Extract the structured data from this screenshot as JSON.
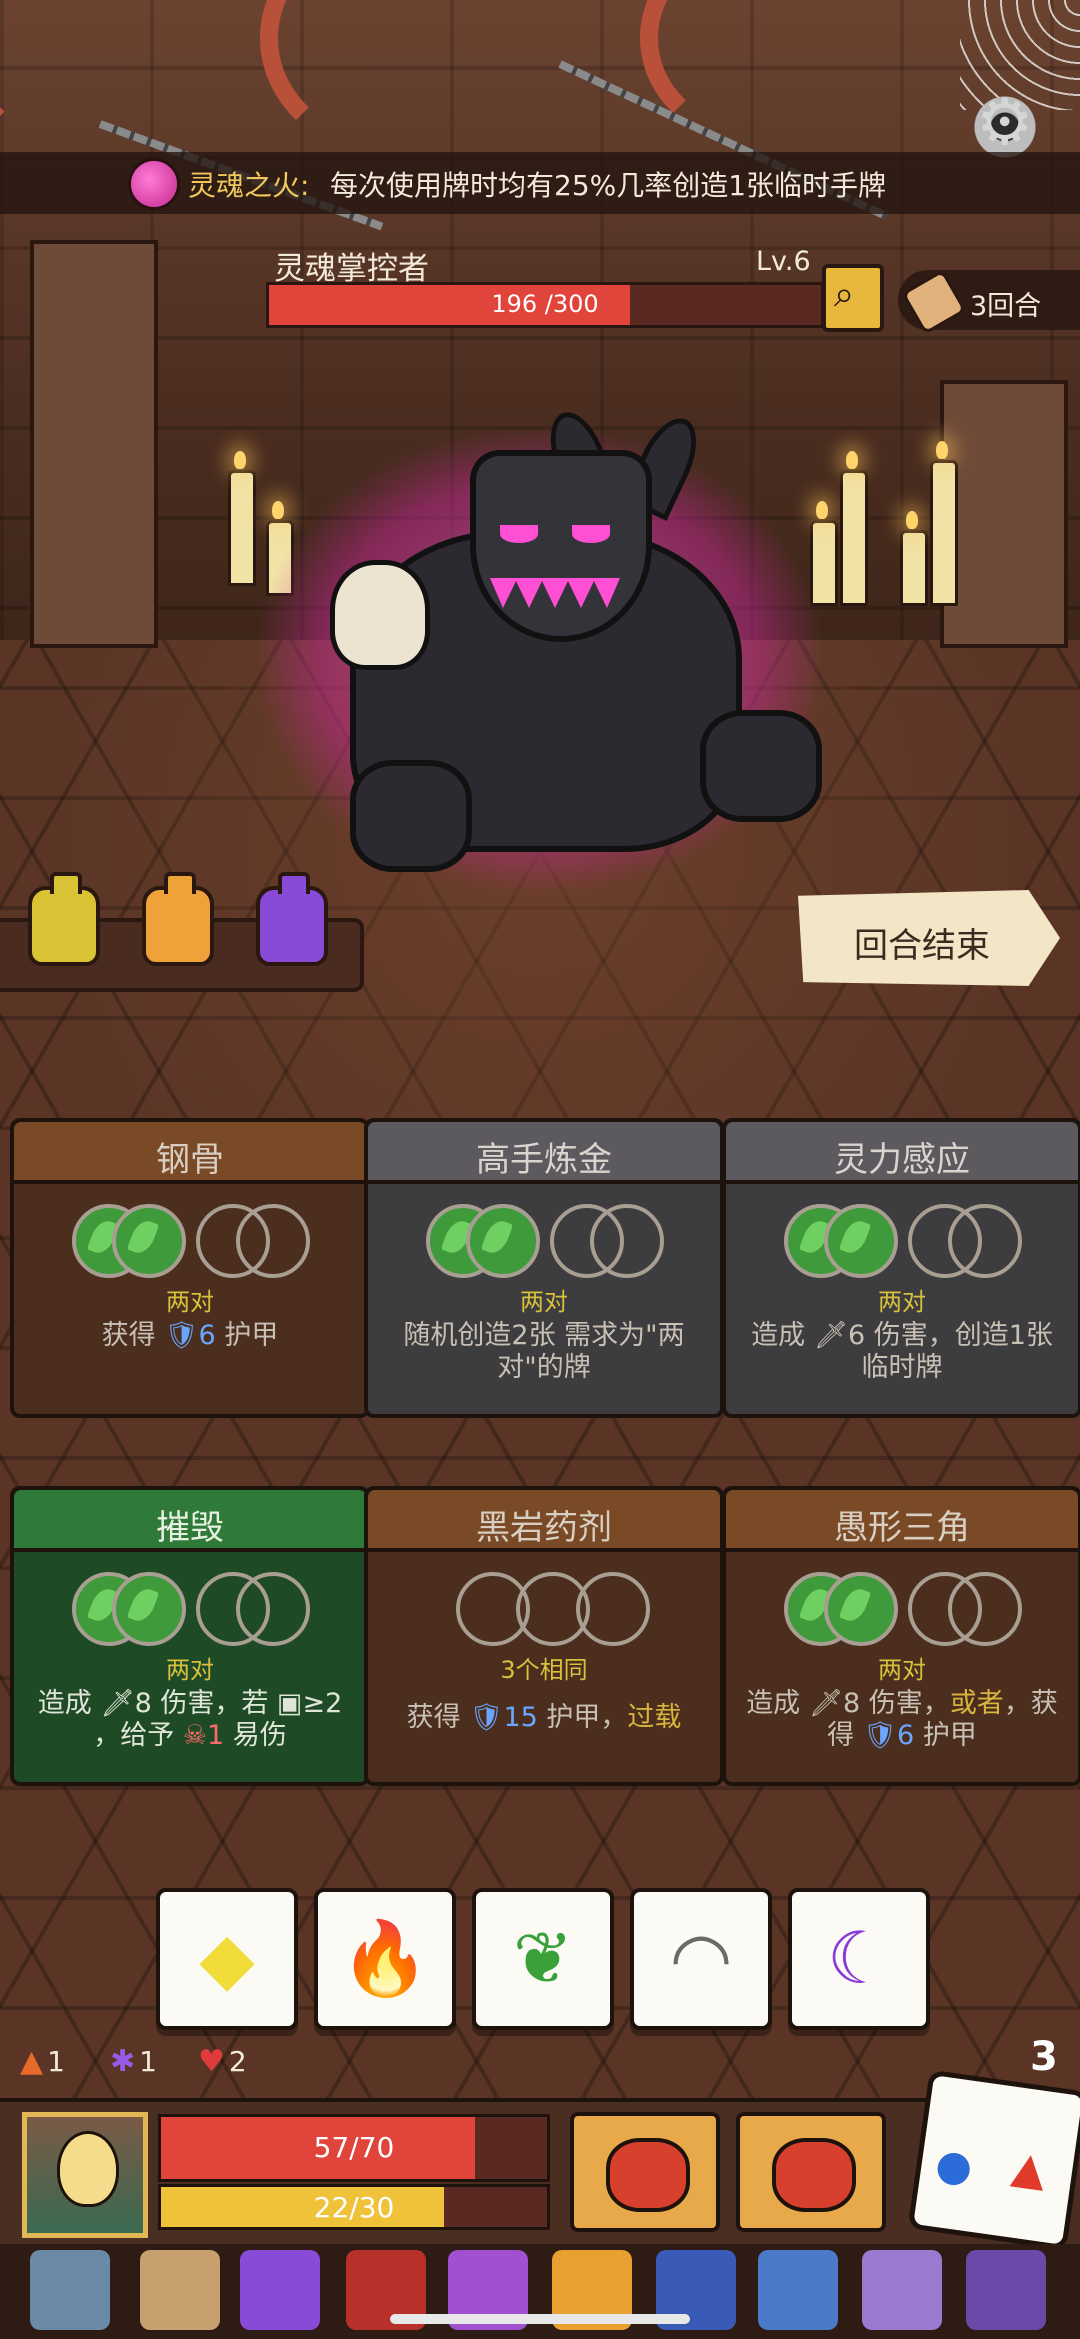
{
  "buff": {
    "name": "灵魂之火:",
    "description": "每次使用牌时均有25%几率创造1张临时手牌",
    "icon": "pink-flame-icon"
  },
  "enemy": {
    "name": "灵魂掌控者",
    "level": "Lv.6",
    "hp_text": "196 /300",
    "hp_fraction": 0.6533,
    "inspect_icon": "magnifier-icon"
  },
  "round": {
    "label": "3回合",
    "icon": "scroll-icon"
  },
  "end_turn": {
    "label": "回合结束"
  },
  "potions": [
    {
      "name": "yellow-green-potion",
      "color": "#d9c233"
    },
    {
      "name": "orange-potion",
      "color": "#f0a23a"
    },
    {
      "name": "purple-potion",
      "color": "#8a4ad8"
    }
  ],
  "cards": [
    {
      "title": "钢骨",
      "requirement": "两对",
      "desc_parts": [
        "获得 ",
        "🛡6",
        " 护甲"
      ],
      "style": "brown"
    },
    {
      "title": "高手炼金",
      "requirement": "两对",
      "desc_parts": [
        "随机创造2张 需求为\"两对\"的牌",
        "",
        ""
      ],
      "style": "gray"
    },
    {
      "title": "灵力感应",
      "requirement": "两对",
      "desc_parts": [
        "造成 ",
        "🗡6",
        " 伤害，创造1张临时牌"
      ],
      "style": "gray"
    },
    {
      "title": "摧毁",
      "requirement": "两对",
      "desc_line1": "造成 🗡8 伤害，若 ▣≥2",
      "desc_line2a": "，给予 ",
      "desc_line2b": "☠1",
      "desc_line2c": " 易伤",
      "style": "green"
    },
    {
      "title": "黑岩药剂",
      "requirement": "3个相同",
      "desc_a": "获得 ",
      "desc_b": "🛡15",
      "desc_c": " 护甲，",
      "desc_d": "过载",
      "style": "brown"
    },
    {
      "title": "愚形三角",
      "requirement": "两对",
      "desc_a": "造成 🗡8 伤害，",
      "desc_b": "或者",
      "desc_c": "，获得 ",
      "desc_d": "🛡6",
      "desc_e": " 护甲",
      "style": "brown"
    }
  ],
  "dice": [
    {
      "face": "diamond-icon",
      "glyph": "◆",
      "color": "#f2dc3a"
    },
    {
      "face": "flame-icon",
      "glyph": "🔥",
      "color": "#e03a2a"
    },
    {
      "face": "leaf-icon",
      "glyph": "❦",
      "color": "#3aa03a"
    },
    {
      "face": "closed-eye-icon",
      "glyph": "◠",
      "color": "#6a6a6a"
    },
    {
      "face": "moon-icon",
      "glyph": "☾",
      "color": "#8a3ad8"
    }
  ],
  "status": {
    "flame": "1",
    "purple": "1",
    "shield": "2",
    "dice_count": "3"
  },
  "player": {
    "hp_text": "57/70",
    "hp_fraction": 0.8143,
    "energy_text": "22/30",
    "energy_fraction": 0.7333
  },
  "colors": {
    "hp": "#e0443a",
    "energy": "#f0c23a",
    "accent": "#e8b83c"
  }
}
